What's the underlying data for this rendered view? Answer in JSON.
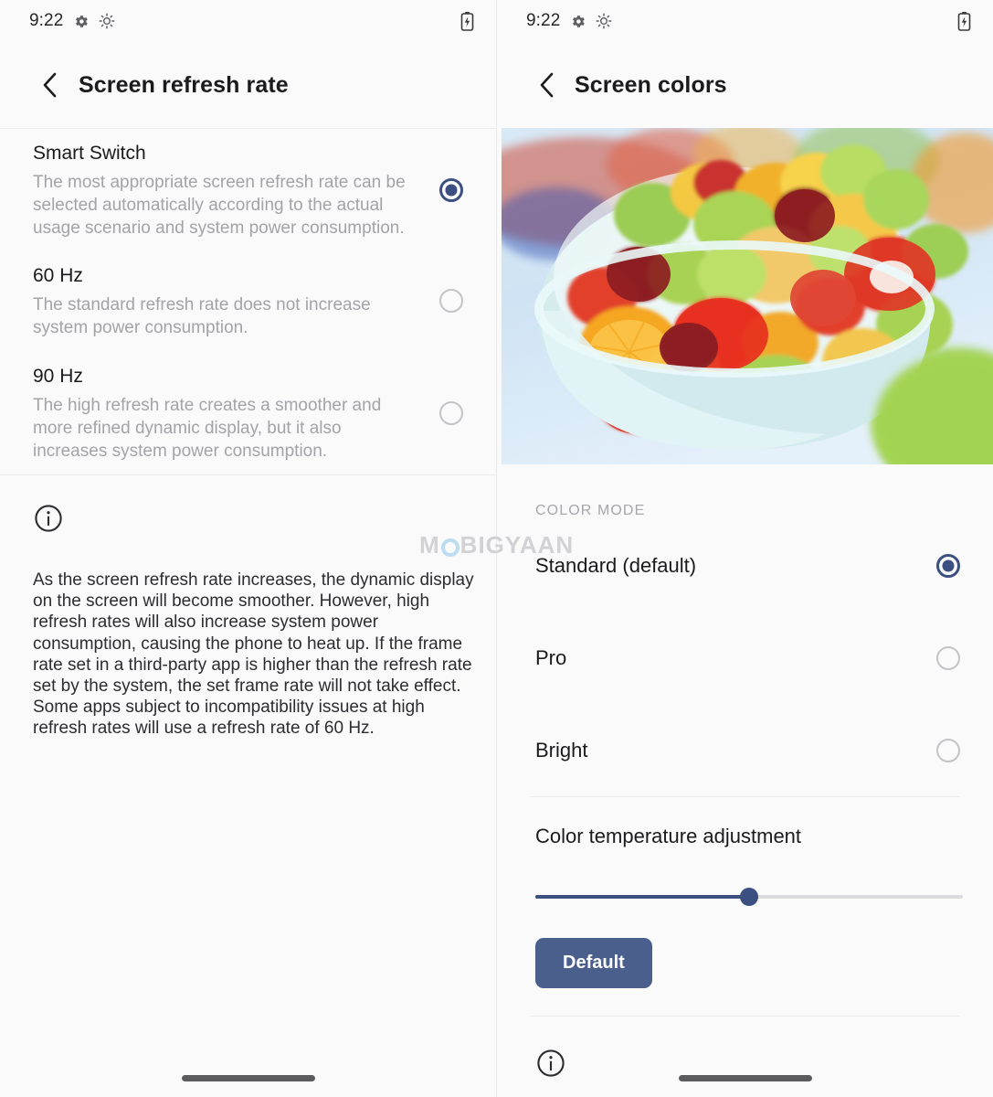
{
  "watermark": {
    "text_before": "M",
    "text_after": "BIGYAAN"
  },
  "left_screen": {
    "status_bar": {
      "time": "9:22",
      "icons": [
        "gear-icon",
        "gear-sun-icon"
      ],
      "right_icons": [
        "battery-charging-icon"
      ]
    },
    "app_bar": {
      "back_icon": "chevron-left-icon",
      "title": "Screen refresh rate"
    },
    "options": [
      {
        "title": "Smart Switch",
        "description": "The most appropriate screen refresh rate can be selected automatically according to the actual usage scenario and system power consumption.",
        "selected": true
      },
      {
        "title": "60 Hz",
        "description": "The standard refresh rate does not increase system power consumption.",
        "selected": false
      },
      {
        "title": "90 Hz",
        "description": "The high refresh rate creates a smoother and more refined dynamic display, but it also increases system power consumption.",
        "selected": false
      }
    ],
    "info": {
      "icon": "info-circle-icon",
      "text": "As the screen refresh rate increases, the dynamic display on the screen will become smoother. However, high refresh rates will also increase system power consumption, causing the phone to heat up. If the frame rate set in a third-party app is higher than the refresh rate set by the system, the set frame rate will not take effect. Some apps subject to incompatibility issues at high refresh rates will use a refresh rate of 60 Hz."
    }
  },
  "right_screen": {
    "status_bar": {
      "time": "9:22",
      "icons": [
        "gear-icon",
        "gear-sun-icon"
      ],
      "right_icons": [
        "battery-charging-icon"
      ]
    },
    "app_bar": {
      "back_icon": "chevron-left-icon",
      "title": "Screen colors"
    },
    "preview_image": {
      "alt": "fruit-salad-bowl-preview"
    },
    "color_mode": {
      "section_label": "COLOR MODE",
      "options": [
        {
          "label": "Standard (default)",
          "selected": true
        },
        {
          "label": "Pro",
          "selected": false
        },
        {
          "label": "Bright",
          "selected": false
        }
      ]
    },
    "temperature": {
      "title": "Color temperature adjustment",
      "slider_percent": 50,
      "default_button": "Default"
    },
    "bottom_info_icon": "info-circle-icon"
  },
  "colors": {
    "accent": "#3b5080",
    "button": "#4a5f8c",
    "track": "#dcdce0",
    "radio_off": "#c3c3c8",
    "text_primary": "#1b1b1e",
    "text_secondary": "#a3a3a8",
    "background": "#fafafa"
  }
}
